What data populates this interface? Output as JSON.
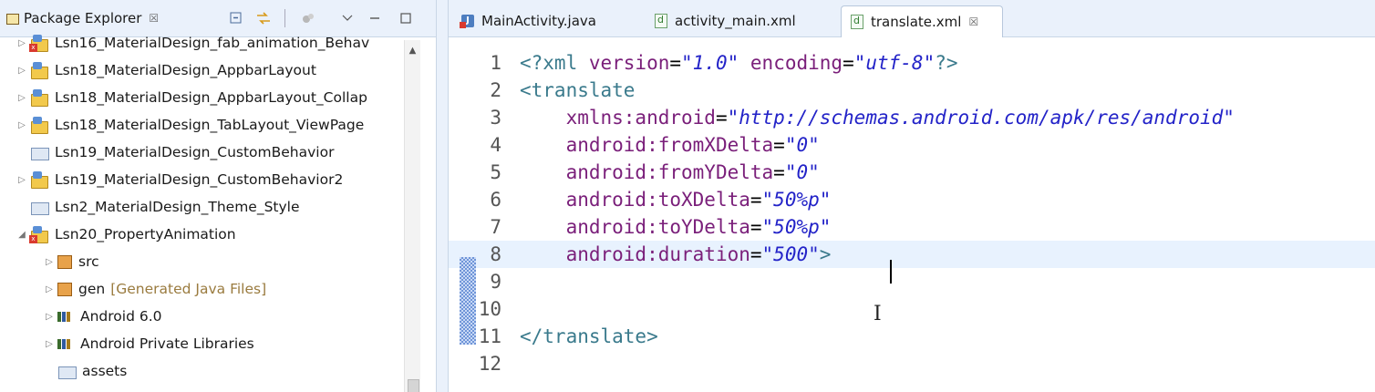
{
  "explorer": {
    "title": "Package Explorer",
    "close_glyph": "☒",
    "toolbar": [
      "collapse-all-icon",
      "link-with-editor-icon",
      "filters-icon",
      "view-menu-icon",
      "minimize-icon",
      "maximize-icon"
    ],
    "scroll_up": "▲",
    "items": [
      {
        "label": "Lsn16_MaterialDesign_fab_animation_Behav",
        "twisty": "▷",
        "icon": "android-project-icon",
        "error": true
      },
      {
        "label": "Lsn18_MaterialDesign_AppbarLayout",
        "twisty": "▷",
        "icon": "android-project-icon",
        "error": false
      },
      {
        "label": "Lsn18_MaterialDesign_AppbarLayout_Collap",
        "twisty": "▷",
        "icon": "android-project-icon",
        "error": false
      },
      {
        "label": "Lsn18_MaterialDesign_TabLayout_ViewPage",
        "twisty": "▷",
        "icon": "android-project-icon",
        "error": false
      },
      {
        "label": "Lsn19_MaterialDesign_CustomBehavior",
        "twisty": "",
        "icon": "closed-project-icon",
        "error": false
      },
      {
        "label": "Lsn19_MaterialDesign_CustomBehavior2",
        "twisty": "▷",
        "icon": "android-project-icon",
        "error": false
      },
      {
        "label": "Lsn2_MaterialDesign_Theme_Style",
        "twisty": "",
        "icon": "closed-project-icon",
        "error": false
      },
      {
        "label": "Lsn20_PropertyAnimation",
        "twisty": "◢",
        "icon": "android-project-icon",
        "error": true
      },
      {
        "label": "src",
        "twisty": "▷",
        "icon": "source-folder-icon",
        "error": true
      },
      {
        "label": "gen",
        "decoration": "[Generated Java Files]",
        "twisty": "▷",
        "icon": "generated-folder-icon",
        "error": false
      },
      {
        "label": "Android 6.0",
        "twisty": "▷",
        "icon": "library-icon",
        "error": false
      },
      {
        "label": "Android Private Libraries",
        "twisty": "▷",
        "icon": "library-icon",
        "error": false
      },
      {
        "label": "assets",
        "twisty": "",
        "icon": "folder-icon",
        "error": false
      }
    ]
  },
  "editor": {
    "tabs": [
      {
        "label": "MainActivity.java",
        "icon": "java-file-icon",
        "active": false
      },
      {
        "label": "activity_main.xml",
        "icon": "xml-file-icon",
        "active": false
      },
      {
        "label": "translate.xml",
        "icon": "xml-file-icon",
        "active": true
      }
    ],
    "close_glyph": "☒",
    "cursor_line": 8,
    "lines": [
      {
        "n": "1",
        "tokens": [
          [
            "tag",
            "<?xml "
          ],
          [
            "attr",
            "version"
          ],
          [
            "eq",
            "="
          ],
          [
            "val",
            "\"1.0\""
          ],
          [
            "eq",
            " "
          ],
          [
            "attr",
            "encoding"
          ],
          [
            "eq",
            "="
          ],
          [
            "val",
            "\"utf-8\""
          ],
          [
            "tag",
            "?>"
          ]
        ]
      },
      {
        "n": "2",
        "tokens": [
          [
            "tag",
            "<translate"
          ]
        ]
      },
      {
        "n": "3",
        "tokens": [
          [
            "eq",
            "    "
          ],
          [
            "attr",
            "xmlns:android"
          ],
          [
            "eq",
            "="
          ],
          [
            "val",
            "\"http://schemas.android.com/apk/res/android\""
          ]
        ]
      },
      {
        "n": "4",
        "tokens": [
          [
            "eq",
            "    "
          ],
          [
            "attr",
            "android:fromXDelta"
          ],
          [
            "eq",
            "="
          ],
          [
            "val",
            "\"0\""
          ]
        ]
      },
      {
        "n": "5",
        "tokens": [
          [
            "eq",
            "    "
          ],
          [
            "attr",
            "android:fromYDelta"
          ],
          [
            "eq",
            "="
          ],
          [
            "val",
            "\"0\""
          ]
        ]
      },
      {
        "n": "6",
        "tokens": [
          [
            "eq",
            "    "
          ],
          [
            "attr",
            "android:toXDelta"
          ],
          [
            "eq",
            "="
          ],
          [
            "val",
            "\"50%p\""
          ]
        ]
      },
      {
        "n": "7",
        "tokens": [
          [
            "eq",
            "    "
          ],
          [
            "attr",
            "android:toYDelta"
          ],
          [
            "eq",
            "="
          ],
          [
            "val",
            "\"50%p\""
          ]
        ]
      },
      {
        "n": "8",
        "tokens": [
          [
            "eq",
            "    "
          ],
          [
            "attr",
            "android:duration"
          ],
          [
            "eq",
            "="
          ],
          [
            "val",
            "\"500\""
          ],
          [
            "tag",
            ">"
          ]
        ]
      },
      {
        "n": "9",
        "tokens": []
      },
      {
        "n": "10",
        "tokens": []
      },
      {
        "n": "11",
        "tokens": [
          [
            "tag",
            "</translate>"
          ]
        ]
      },
      {
        "n": "12",
        "tokens": []
      }
    ],
    "ibeam_glyph": "I"
  }
}
